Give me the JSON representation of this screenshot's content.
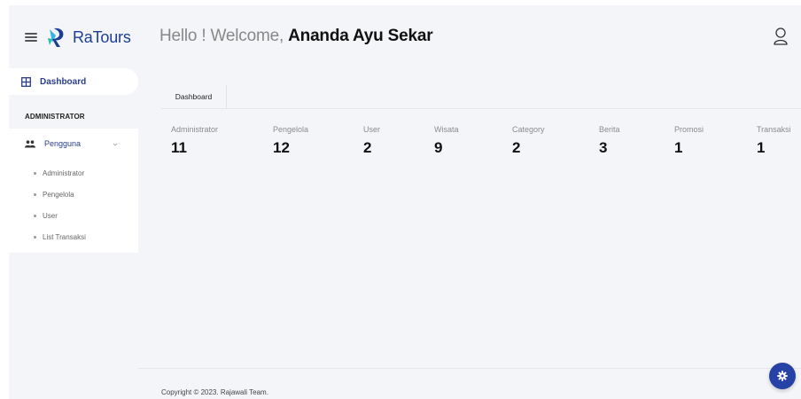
{
  "brand": {
    "name": "RaTours"
  },
  "sidebar": {
    "dashboard_label": "Dashboard",
    "section_title": "ADMINISTRATOR",
    "pengguna_label": "Pengguna",
    "items": [
      {
        "label": "Administrator"
      },
      {
        "label": "Pengelola"
      },
      {
        "label": "User"
      },
      {
        "label": "List Transaksi"
      }
    ]
  },
  "header": {
    "greeting": "Hello ! Welcome, ",
    "user_name": "Ananda Ayu Sekar"
  },
  "tabs": [
    {
      "label": "Dashboard"
    }
  ],
  "stats": [
    {
      "label": "Administrator",
      "value": "11"
    },
    {
      "label": "Pengelola",
      "value": "12"
    },
    {
      "label": "User",
      "value": "2"
    },
    {
      "label": "Wisata",
      "value": "9"
    },
    {
      "label": "Category",
      "value": "2"
    },
    {
      "label": "Berita",
      "value": "3"
    },
    {
      "label": "Promosi",
      "value": "1"
    },
    {
      "label": "Transaksi",
      "value": "1"
    }
  ],
  "footer": {
    "copyright": "Copyright © 2023. Rajawali Team."
  },
  "colors": {
    "brand": "#1c3f95",
    "accent": "#2742a6",
    "background": "#f4f5f8"
  },
  "icons": {
    "menu": "hamburger-icon",
    "logo": "ratours-logo-icon",
    "dashboard": "grid-icon",
    "pengguna": "users-icon",
    "user": "user-icon",
    "settings": "gear-icon"
  }
}
